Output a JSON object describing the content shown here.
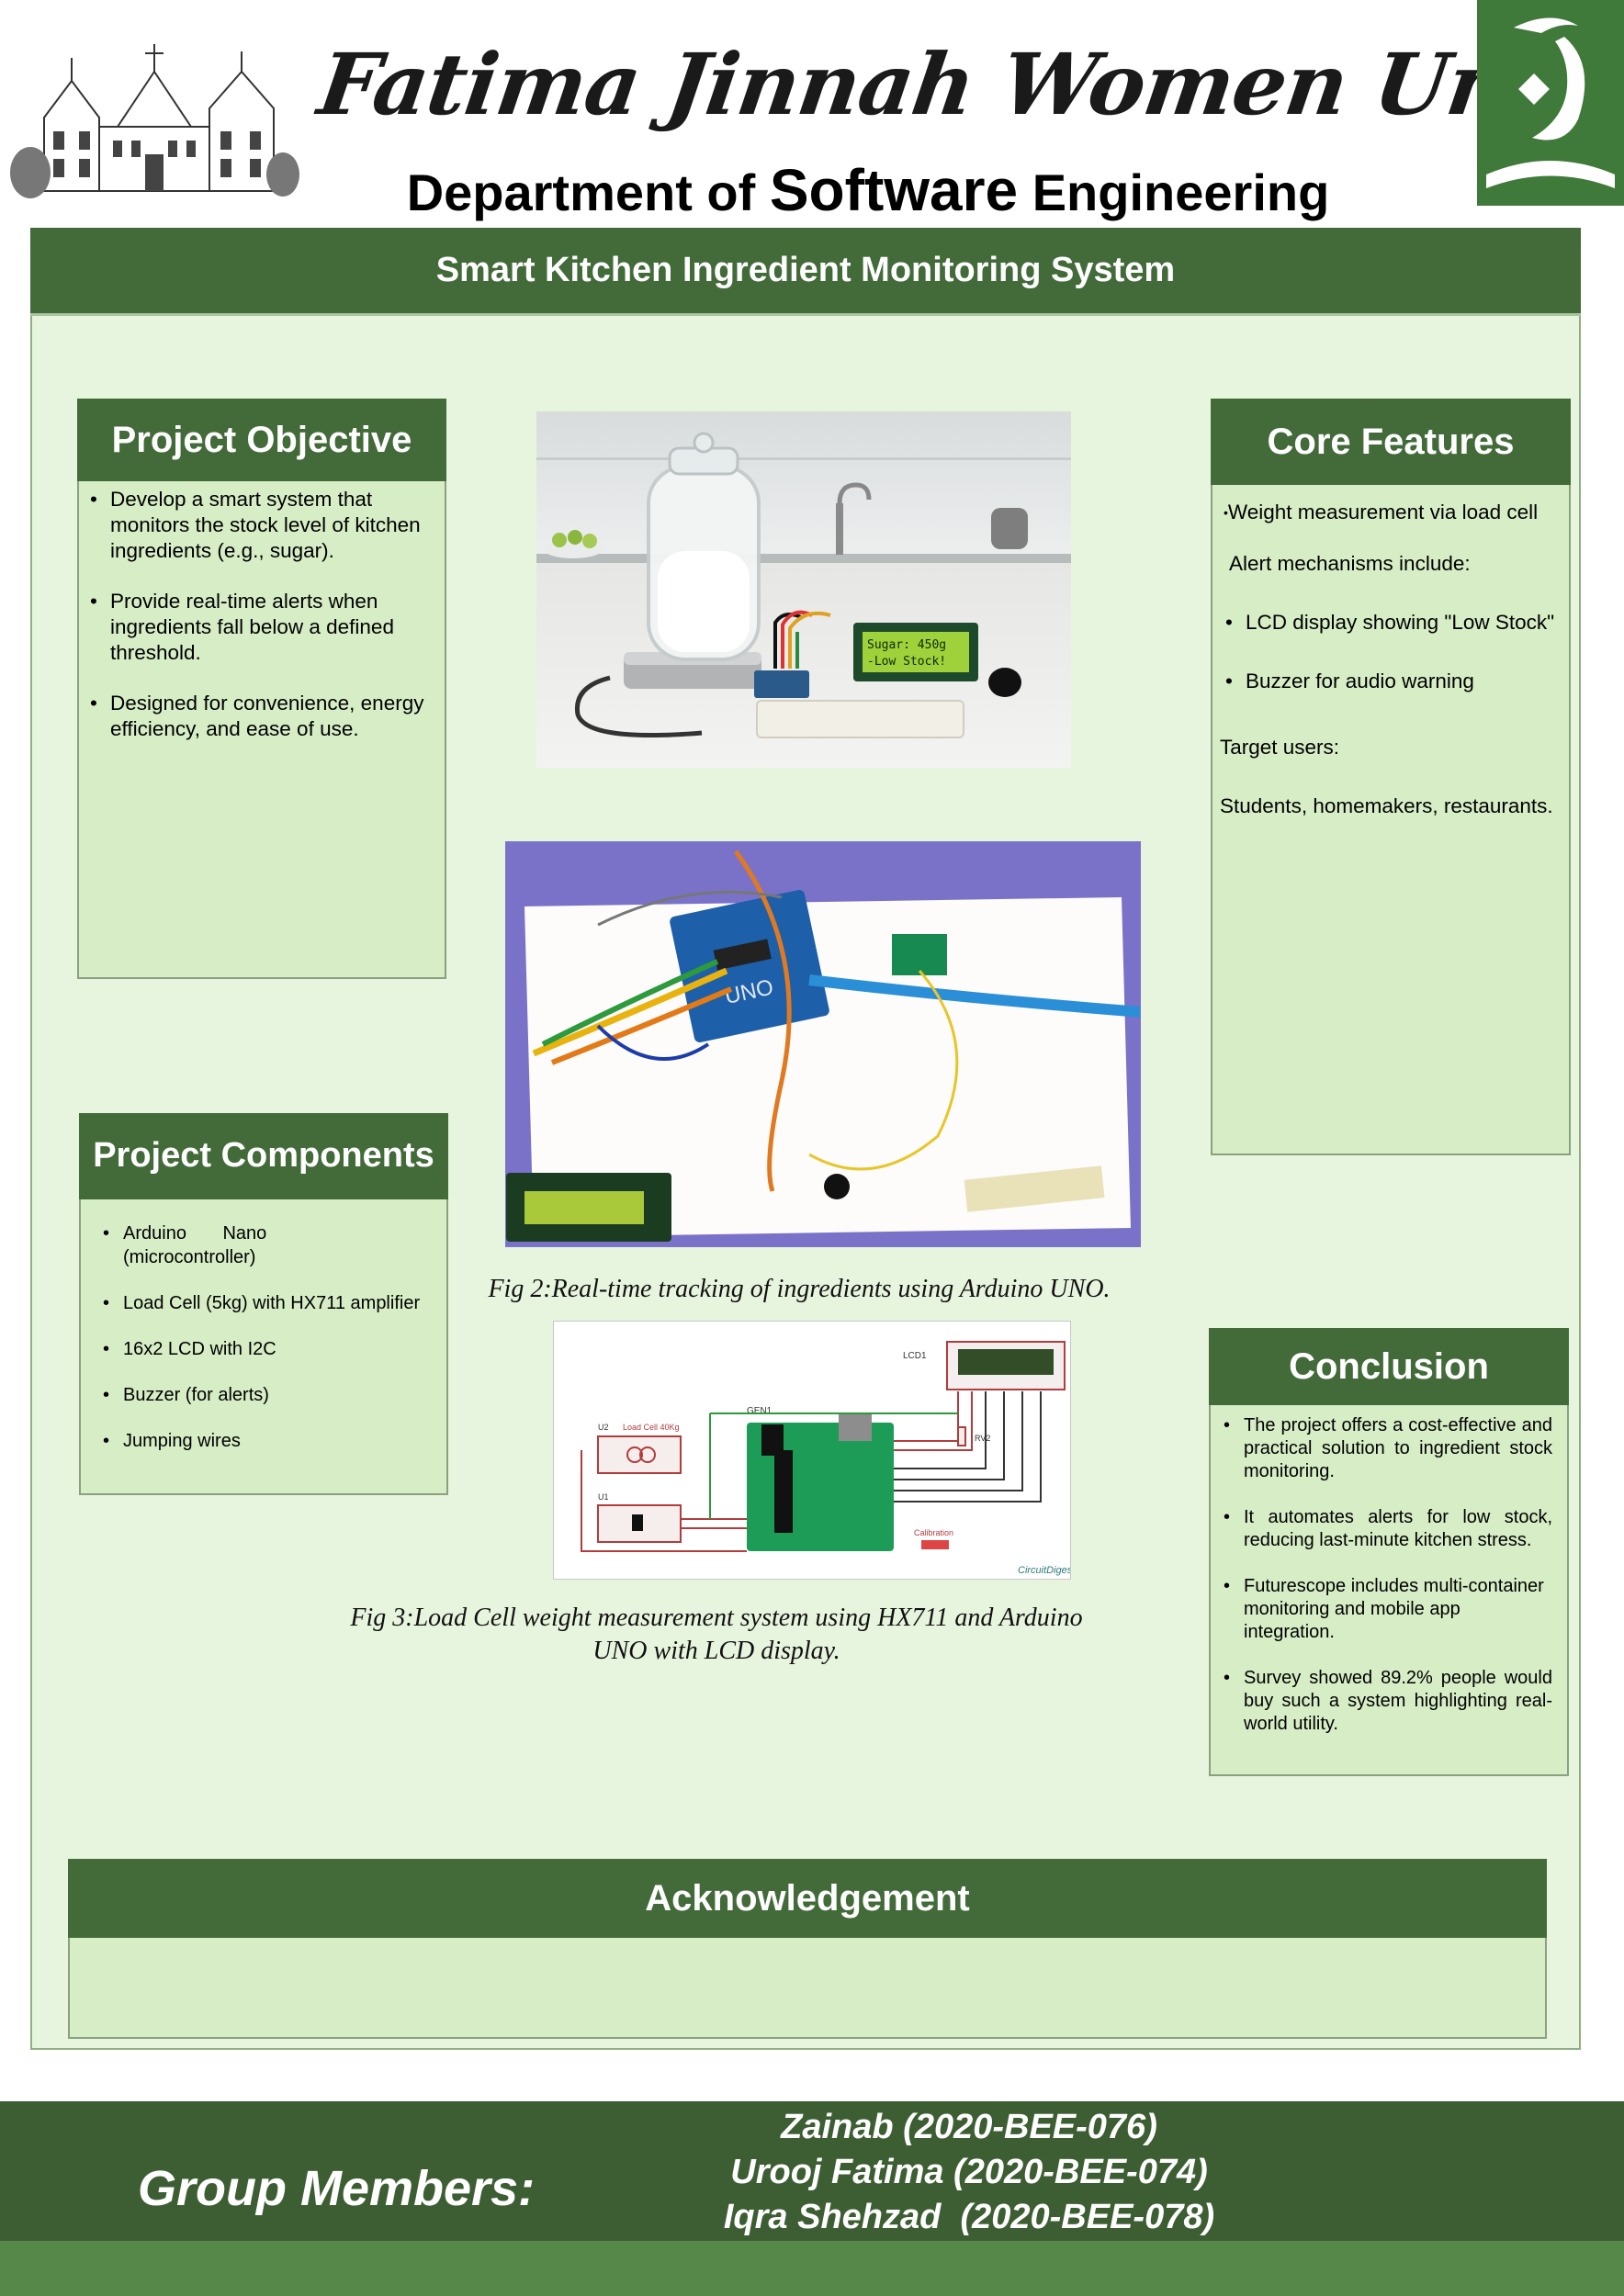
{
  "header": {
    "university": "Fatima Jinnah Women University",
    "dept_prefix": "Department of ",
    "dept_big": "Software",
    "dept_suffix": " Engineering"
  },
  "poster": {
    "title": "Smart Kitchen Ingredient Monitoring System"
  },
  "objective": {
    "heading": "Project Objective",
    "items": [
      "Develop a smart system that monitors the stock level of kitchen ingredients (e.g., sugar).",
      "Provide real-time alerts when ingredients fall below a defined threshold.",
      "Designed for convenience, energy efficiency, and ease of use."
    ]
  },
  "components": {
    "heading": "Project Components",
    "items": [
      "Arduino Nano (microcontroller)",
      "Load Cell (5kg) with HX711 amplifier",
      "16x2 LCD with I2C",
      "Buzzer (for alerts)",
      "Jumping wires"
    ]
  },
  "features": {
    "heading": "Core Features",
    "weight": "Weight measurement via load cell",
    "alert_intro": "Alert mechanisms include:",
    "alerts": [
      "LCD display showing \"Low Stock\"",
      "Buzzer for audio warning"
    ],
    "target_label": "Target users:",
    "target_users": "Students, homemakers, restaurants."
  },
  "conclusion": {
    "heading": "Conclusion",
    "items": [
      "The project offers a cost-effective and practical solution to ingredient stock monitoring.",
      "It automates alerts for low stock, reducing last-minute kitchen stress.",
      "Futurescope includes multi-container monitoring and mobile app integration.",
      "Survey showed 89.2% people would buy such a system highlighting real-world utility."
    ]
  },
  "figures": {
    "lcd_line1": "Sugar: 450g",
    "lcd_line2": "-Low Stock!",
    "fig2_caption": "Fig 2:Real-time tracking of ingredients using Arduino UNO.",
    "fig3_caption": "Fig 3:Load Cell weight measurement system using HX711 and Arduino UNO with LCD display.",
    "board_label": "UNO",
    "schematic_labels": {
      "lcd": "LCD1",
      "load_cell": "Load Cell 40Kg",
      "u2": "U2",
      "u1": "U1",
      "gen": "GEN1",
      "rv": "RV2",
      "calibration": "Calibration",
      "brand": "CircuitDigest"
    }
  },
  "acknowledgement": {
    "heading": "Acknowledgement"
  },
  "footer": {
    "label": "Group Members:",
    "members": [
      "Zainab (2020-BEE-076)",
      "Urooj Fatima (2020-BEE-074)",
      "Iqra Shehzad  (2020-BEE-078)"
    ]
  },
  "colors": {
    "header_green": "#436b3a",
    "panel_green": "#d6edc5",
    "frame_green": "#e8f5de",
    "footer_green": "#3d5e33"
  }
}
